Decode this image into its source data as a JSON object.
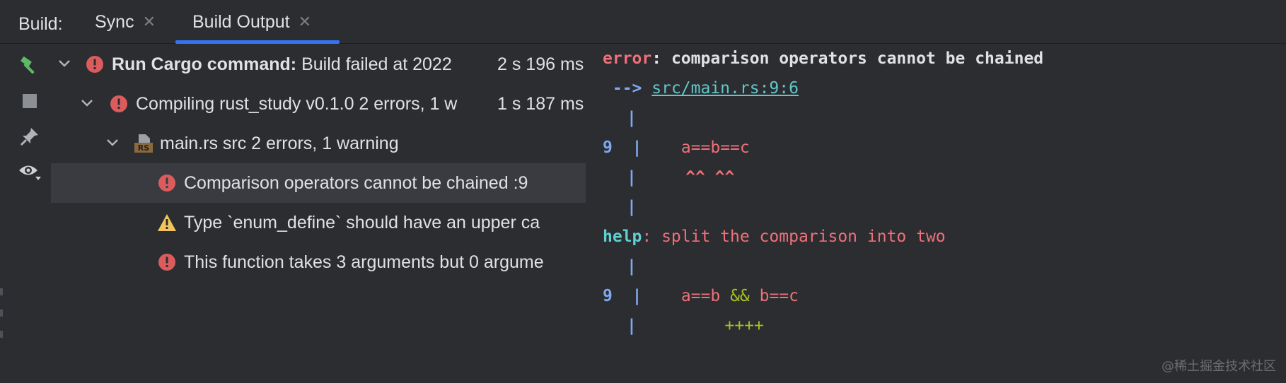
{
  "tabbar": {
    "label": "Build:",
    "tabs": [
      {
        "label": "Sync",
        "close": "✕"
      },
      {
        "label": "Build Output",
        "close": "✕"
      }
    ]
  },
  "tree": {
    "rows": [
      {
        "title": "Run Cargo command:",
        "text": " Build failed at 2022",
        "time": "2 s 196 ms"
      },
      {
        "text": "Compiling rust_study v0.1.0  2 errors, 1 w",
        "time": "1 s 187 ms"
      },
      {
        "text": "main.rs src 2 errors, 1 warning",
        "file_badge": "RS"
      },
      {
        "text": "Comparison operators cannot be chained :9"
      },
      {
        "text": "Type `enum_define` should have an upper ca"
      },
      {
        "text": "This function takes 3 arguments but 0 argume"
      }
    ]
  },
  "console": {
    "error_label": "error",
    "error_message": ": comparison operators cannot be chained",
    "arrow": " -->",
    "location": "src/main.rs:9:6",
    "pipe": "|",
    "line_no": "9",
    "code1": "a==b==c",
    "carets": "^^ ^^",
    "help_label": "help",
    "help_message": ": split the comparison into two",
    "code2_a": "a==b ",
    "code2_op": "&&",
    "code2_b": " b==c",
    "pluses": "++++"
  },
  "watermark": "@稀土掘金技术社区",
  "colors": {
    "accent": "#3574f0",
    "error": "#db5c5c",
    "warning": "#f2c55c",
    "background": "#2b2d30"
  }
}
